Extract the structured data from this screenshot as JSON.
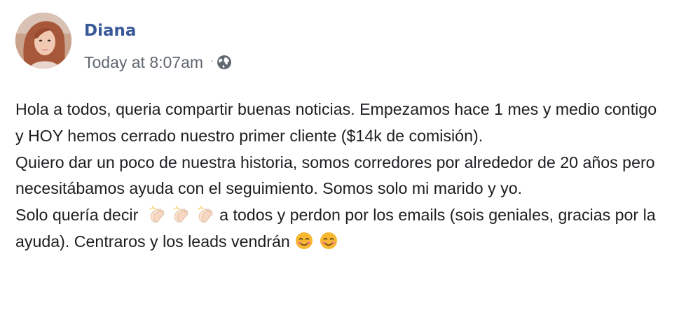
{
  "post": {
    "author": "Diana",
    "timestamp": "Today at 8:07am",
    "separator": "·",
    "privacy_icon": "globe-icon",
    "avatar_icon": "user-avatar",
    "paragraphs": [
      "Hola a todos, queria compartir buenas noticias. Empezamos hace 1 mes y medio contigo y HOY hemos cerrado nuestro primer cliente ($14k de comisión).",
      "Quiero dar un poco de nuestra historia, somos corredores por alrededor de 20 años pero necesitábamos ayuda con el seguimiento. Somos solo mi marido y yo."
    ],
    "last_paragraph": {
      "before_emoji": "Solo quería decir",
      "clap_emoji": "👏🏻",
      "clap_count": 3,
      "after_emoji": "a todos y perdon por los emails (sois geniales, gracias por la ayuda). Centraros y los leads vendrán",
      "smile_emoji": "😊",
      "smile_count": 2
    }
  },
  "colors": {
    "author_name": "#385898",
    "timestamp": "#606770",
    "body_text": "#1c1e21",
    "background": "#ffffff",
    "emoji_yellow": "#f7b731",
    "emoji_blush": "#f4847a",
    "clap_skin": "#fbe3d0"
  }
}
